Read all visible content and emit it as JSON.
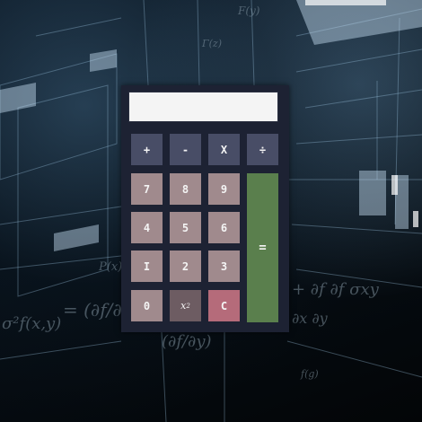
{
  "background": {
    "formulas": [
      "σ²f(x,y)",
      "= (∂f/∂x)σ",
      "(∂f/∂y)",
      "+ ∂f ∂f σxy",
      "∂x ∂y",
      "P(x)",
      "F(y)",
      "Γ(z)",
      "f(g)"
    ]
  },
  "calculator": {
    "display_value": "",
    "colors": {
      "frame": "#1d2233",
      "operator_key": "#484d66",
      "number_key": "#a08a8d",
      "square_key": "#6d5c62",
      "clear_key": "#b56b7a",
      "equals_key": "#5a7f4d",
      "display": "#f4f4f4"
    },
    "operators": {
      "add": "+",
      "subtract": "-",
      "multiply": "X",
      "divide": "÷"
    },
    "digits": {
      "seven": "7",
      "eight": "8",
      "nine": "9",
      "four": "4",
      "five": "5",
      "six": "6",
      "one": "I",
      "two": "2",
      "three": "3",
      "zero": "0"
    },
    "square": {
      "base": "x",
      "exponent": "2"
    },
    "clear": "C",
    "equals": "="
  }
}
